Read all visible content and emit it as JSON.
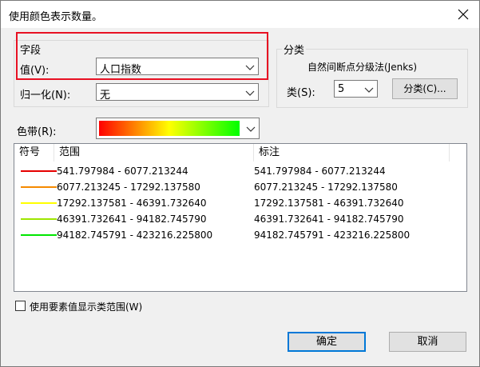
{
  "window": {
    "title": "使用颜色表示数量。"
  },
  "fields": {
    "group_label": "字段",
    "value_label": "值(V):",
    "value_selected": "人口指数",
    "normalize_label": "归一化(N):",
    "normalize_selected": "无"
  },
  "classification": {
    "group_label": "分类",
    "method": "自然间断点分级法(Jenks)",
    "classes_label": "类(S):",
    "classes_value": "5",
    "classify_button": "分类(C)..."
  },
  "color_ramp": {
    "label": "色带(R):",
    "colors": [
      "#ff0000",
      "#ffff00",
      "#00ff00"
    ]
  },
  "table": {
    "headers": [
      "符号",
      "范围",
      "标注"
    ],
    "rows": [
      {
        "color": "#e60000",
        "range": "541.797984 - 6077.213244",
        "label": "541.797984 - 6077.213244"
      },
      {
        "color": "#f58a00",
        "range": "6077.213245 - 17292.137580",
        "label": "6077.213245 - 17292.137580"
      },
      {
        "color": "#ffff00",
        "range": "17292.137581 - 46391.732640",
        "label": "17292.137581 - 46391.732640"
      },
      {
        "color": "#9ee600",
        "range": "46391.732641 - 94182.745790",
        "label": "46391.732641 - 94182.745790"
      },
      {
        "color": "#00e600",
        "range": "94182.745791 - 423216.225800",
        "label": "94182.745791 - 423216.225800"
      }
    ]
  },
  "options": {
    "use_feature_values_label": "使用要素值显示类范围(W)"
  },
  "buttons": {
    "ok": "确定",
    "cancel": "取消"
  },
  "colors": {
    "highlight_box": "#e81123",
    "accent": "#0078d7"
  }
}
